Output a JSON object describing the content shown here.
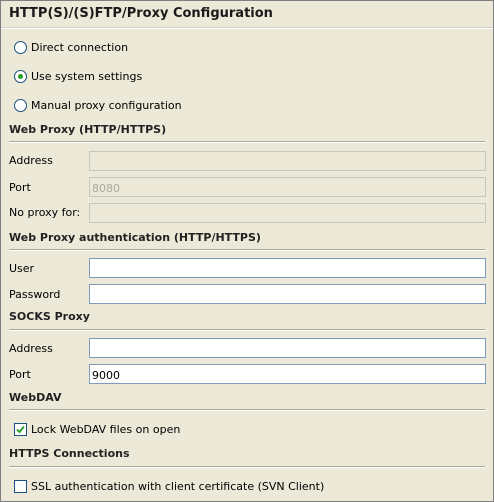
{
  "title": "HTTP(S)/(S)FTP/Proxy Configuration",
  "connection": {
    "options": [
      {
        "label": "Direct connection",
        "selected": false
      },
      {
        "label": "Use system settings",
        "selected": true
      },
      {
        "label": "Manual proxy configuration",
        "selected": false
      }
    ]
  },
  "web_proxy": {
    "heading": "Web Proxy (HTTP/HTTPS)",
    "address_label": "Address",
    "address_value": "",
    "port_label": "Port",
    "port_value": "8080",
    "no_proxy_label": "No proxy for:",
    "no_proxy_value": ""
  },
  "web_proxy_auth": {
    "heading": "Web Proxy authentication (HTTP/HTTPS)",
    "user_label": "User",
    "user_value": "",
    "password_label": "Password",
    "password_value": ""
  },
  "socks_proxy": {
    "heading": "SOCKS Proxy",
    "address_label": "Address",
    "address_value": "",
    "port_label": "Port",
    "port_value": "9000"
  },
  "webdav": {
    "heading": "WebDAV",
    "lock_label": "Lock WebDAV files on open",
    "lock_checked": true
  },
  "https": {
    "heading": "HTTPS Connections",
    "ssl_label": "SSL authentication with client certificate (SVN Client)",
    "ssl_checked": false
  },
  "colors": {
    "radio_selected": "#21a121",
    "check_mark": "#21a121",
    "field_border": "#7f9db9",
    "background": "#ece9d8"
  }
}
